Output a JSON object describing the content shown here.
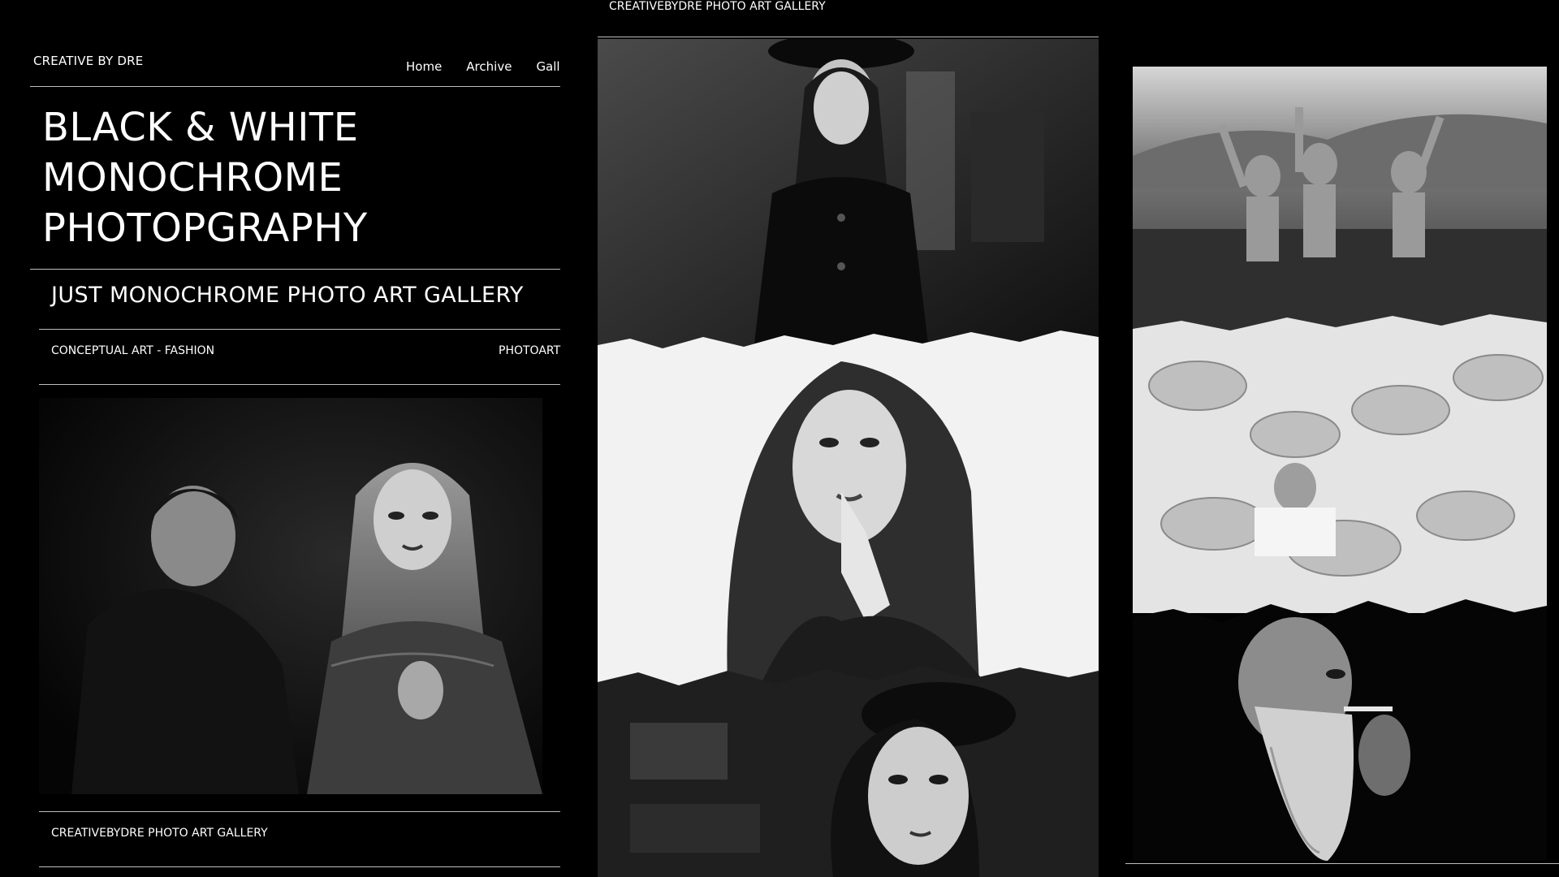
{
  "header": {
    "brand": "CREATIVE BY DRE",
    "nav": [
      "Home",
      "Archive",
      "Gallery"
    ],
    "top_caption": "CREATIVEBYDRE PHOTO ART GALLERY"
  },
  "hero": {
    "title_lines": [
      "BLACK & WHITE",
      "MONOCHROME",
      "PHOTOPGRAPHY"
    ],
    "subtitle": "JUST MONOCHROME PHOTO ART GALLERY"
  },
  "tags": {
    "left": "CONCEPTUAL ART - FASHION",
    "right": "PHOTOART"
  },
  "footer": {
    "caption": "CREATIVEBYDRE PHOTO ART GALLERY"
  },
  "colors": {
    "background": "#000000",
    "text": "#ffffff",
    "rule": "#bdbdbd"
  }
}
